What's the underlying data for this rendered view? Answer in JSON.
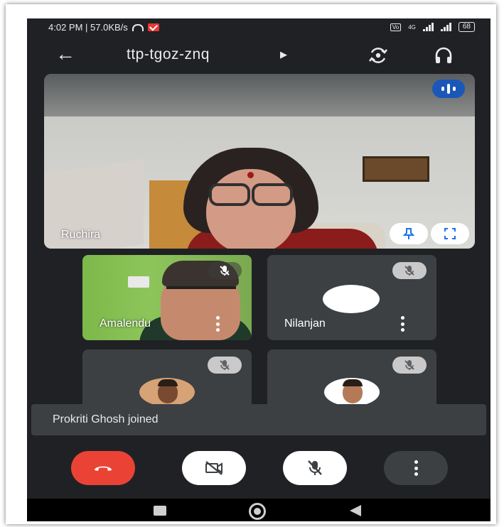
{
  "status_bar": {
    "time_speed": "4:02 PM | 57.0KB/s",
    "network": "4G",
    "battery": "68"
  },
  "top_bar": {
    "meeting_code": "ttp-tgoz-znq",
    "back_icon": "arrow-back-icon",
    "switch_camera_icon": "switch-camera-icon",
    "audio_output_icon": "headphones-icon"
  },
  "main_tile": {
    "name": "Ruchira",
    "speaking_indicator": "audio-wave-icon",
    "pin_icon": "pin-icon",
    "fullscreen_icon": "fullscreen-icon"
  },
  "tiles": [
    {
      "name": "Amalendu",
      "muted": true
    },
    {
      "name": "Nilanjan",
      "muted": true
    },
    {
      "name": "",
      "muted": true
    },
    {
      "name": "",
      "muted": true
    }
  ],
  "toast": {
    "message": "Prokriti Ghosh joined"
  },
  "controls": {
    "end_call_icon": "phone-hangup-icon",
    "camera_icon": "camera-off-icon",
    "mic_icon": "mic-off-icon",
    "more_icon": "more-vert-icon",
    "end_call_color": "#ea4335"
  },
  "nav_bar": {
    "recents_icon": "square-icon",
    "home_icon": "circle-icon",
    "back_icon": "triangle-back-icon"
  }
}
